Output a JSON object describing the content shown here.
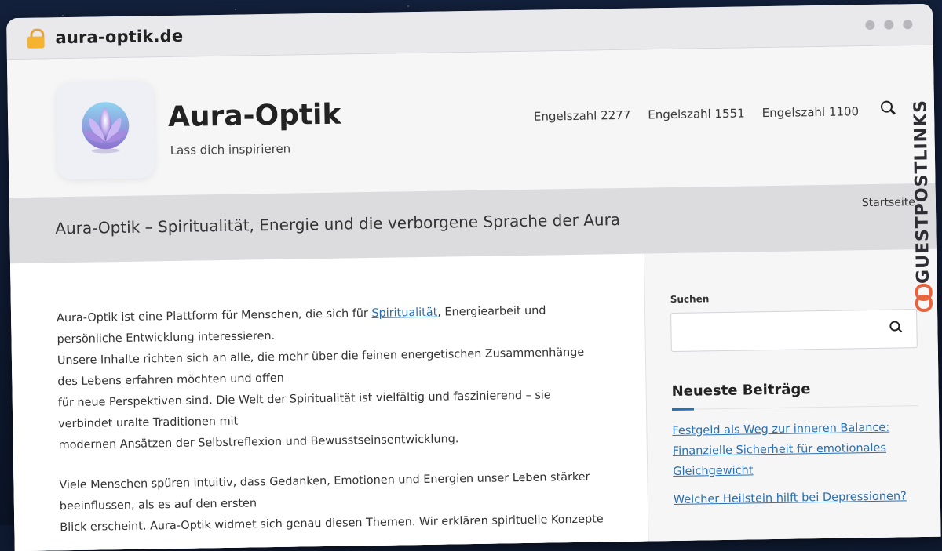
{
  "browser": {
    "url": "aura-optik.de"
  },
  "header": {
    "title": "Aura-Optik",
    "tagline": "Lass dich inspirieren",
    "nav": [
      "Engelszahl 2277",
      "Engelszahl 1551",
      "Engelszahl 1100"
    ]
  },
  "pagebar": {
    "heading": "Aura-Optik – Spiritualität, Energie und die verborgene Sprache der Aura",
    "breadcrumb": "Startseite"
  },
  "main": {
    "p1_before": "Aura-Optik ist eine Plattform für Menschen, die sich für ",
    "p1_link": "Spiritualität",
    "p1_after": ", Energiearbeit und persönliche Entwicklung interessieren.",
    "p1_line2": "Unsere Inhalte richten sich an alle, die mehr über die feinen energetischen Zusammenhänge des Lebens erfahren möchten und offen",
    "p1_line3": "für neue Perspektiven sind. Die Welt der Spiritualität ist vielfältig und faszinierend – sie verbindet uralte Traditionen mit",
    "p1_line4": "modernen Ansätzen der Selbstreflexion und Bewusstseinsentwicklung.",
    "p2_line1": "Viele Menschen spüren intuitiv, dass Gedanken, Emotionen und Energien unser Leben stärker beeinflussen, als es auf den ersten",
    "p2_line2": "Blick erscheint. Aura-Optik widmet sich genau diesen Themen. Wir erklären spirituelle Konzepte"
  },
  "sidebar": {
    "search_label": "Suchen",
    "recent_title": "Neueste Beiträge",
    "posts": [
      "Festgeld als Weg zur inneren Balance: Finanzielle Sicherheit für emotionales Gleichgewicht",
      "Welcher Heilstein hilft bei Depressionen?"
    ]
  },
  "badge": {
    "text": "GUESTPOSTLINKS"
  }
}
